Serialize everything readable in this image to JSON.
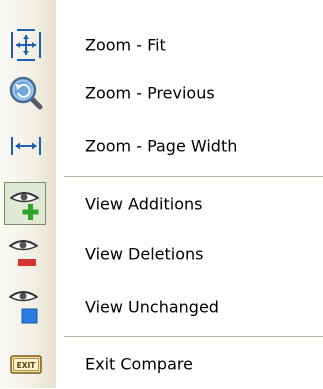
{
  "menu": {
    "items": [
      {
        "label": "Zoom - Fit",
        "icon": "zoom-fit-icon"
      },
      {
        "label": "Zoom - Previous",
        "icon": "zoom-previous-icon"
      },
      {
        "label": "Zoom - Page Width",
        "icon": "zoom-page-width-icon"
      },
      {
        "label": "View Additions",
        "icon": "view-additions-icon",
        "selected": true
      },
      {
        "label": "View Deletions",
        "icon": "view-deletions-icon"
      },
      {
        "label": "View Unchanged",
        "icon": "view-unchanged-icon"
      },
      {
        "label": "Exit Compare",
        "icon": "exit-compare-icon"
      }
    ]
  },
  "colors": {
    "icon_blue": "#1f5fb0",
    "addition_green": "#2fa52b",
    "deletion_red": "#d8332a",
    "unchanged_blue": "#2b7be0"
  }
}
